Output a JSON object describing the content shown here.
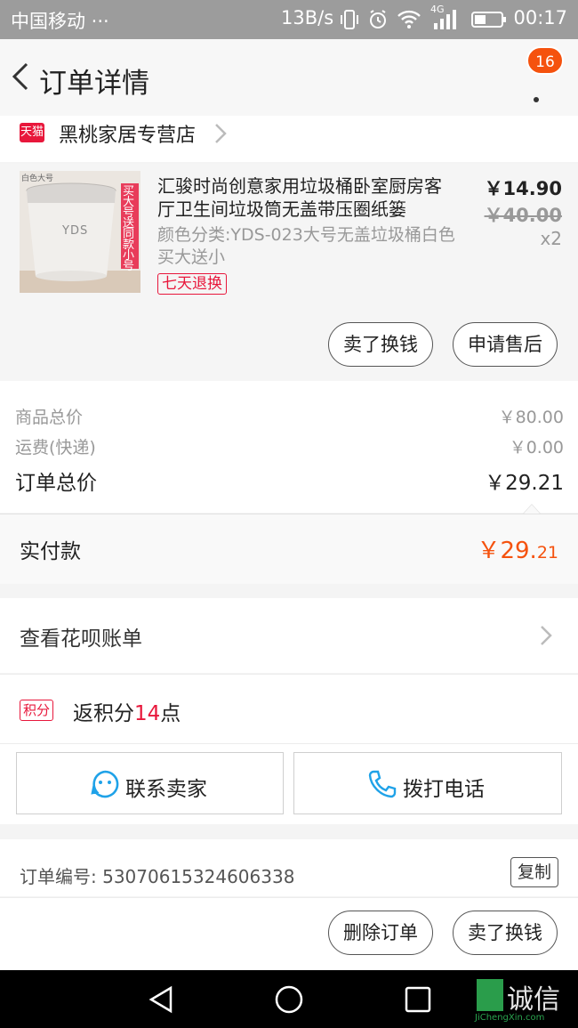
{
  "status_bar": {
    "carrier": "中国移动 ···",
    "speed": "13B/s",
    "network": "4G",
    "time": "00:17"
  },
  "header": {
    "title": "订单详情",
    "badge_count": "16"
  },
  "shop": {
    "platform_tag": "天猫",
    "name": "黑桃家居专营店"
  },
  "item": {
    "thumb_brand": "YDS",
    "thumb_label": "白色大号",
    "thumb_promo": "买大号送同款小号",
    "name": "汇骏时尚创意家用垃圾桶卧室厨房客厅卫生间垃圾筒无盖带压圈纸篓",
    "spec": "颜色分类:YDS-023大号无盖垃圾桶白色 买大送小",
    "return_tag": "七天退换",
    "price": "￥14.90",
    "original_price": "￥40.00",
    "quantity": "x2",
    "actions": [
      "卖了换钱",
      "申请售后"
    ]
  },
  "summary": {
    "goods_total_label": "商品总价",
    "goods_total_value": "￥80.00",
    "shipping_label": "运费(快递)",
    "shipping_value": "￥0.00",
    "order_total_label": "订单总价",
    "order_total_value": "￥29.21",
    "paid_label": "实付款",
    "paid_main": "￥29.",
    "paid_cents": "21"
  },
  "huabei": {
    "label": "查看花呗账单"
  },
  "points": {
    "badge": "积分",
    "prefix": "返积分",
    "number": "14",
    "suffix": "点"
  },
  "contact": {
    "seller": "联系卖家",
    "phone": "拨打电话"
  },
  "order": {
    "number_label": "订单编号: 53070615324606338",
    "copy": "复制"
  },
  "bottom_actions": [
    "删除订单",
    "卖了换钱"
  ],
  "watermark": {
    "text": "诚信",
    "url": "JiChengXin.com"
  },
  "colors": {
    "accent": "#f5520e",
    "tmall_red": "#e8173b",
    "link_blue": "#1fa2e8"
  }
}
